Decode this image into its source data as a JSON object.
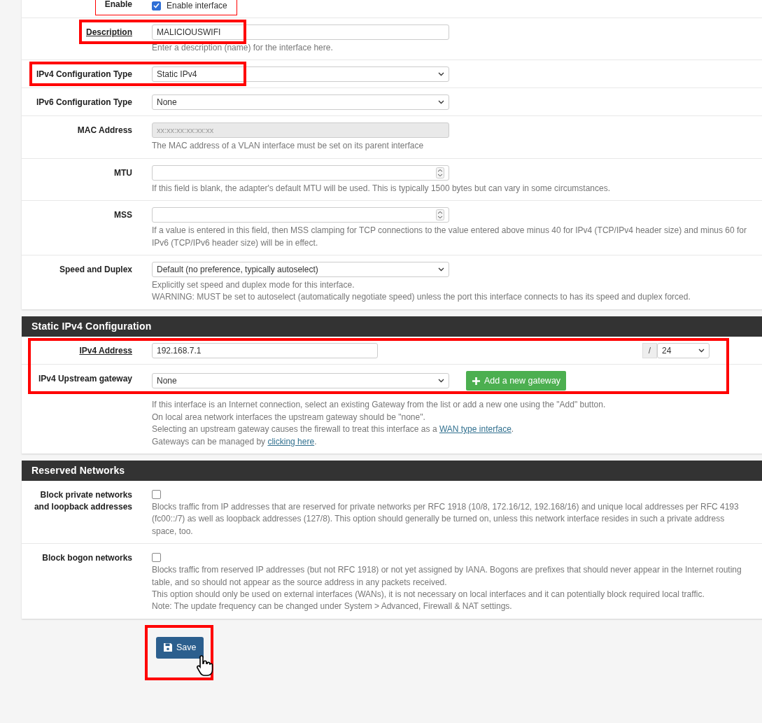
{
  "general": {
    "rows": [
      {
        "kind": "checkbox",
        "label": "Enable",
        "underlined": false,
        "checked": true,
        "option": "Enable interface",
        "highlighted": true
      },
      {
        "kind": "text",
        "label": "Description",
        "underlined": true,
        "value": "MALICIOUSWIFI",
        "highlighted": true,
        "help": [
          "Enter a description (name) for the interface here."
        ]
      },
      {
        "kind": "select",
        "label": "IPv4 Configuration Type",
        "underlined": false,
        "value": "Static IPv4",
        "highlighted": true
      },
      {
        "kind": "select",
        "label": "IPv6 Configuration Type",
        "underlined": false,
        "value": "None",
        "highlighted": false
      },
      {
        "kind": "text",
        "label": "MAC Address",
        "underlined": false,
        "placeholder": "xx:xx:xx:xx:xx:xx",
        "disabled": true,
        "highlighted": false,
        "help": [
          "The MAC address of a VLAN interface must be set on its parent interface"
        ]
      },
      {
        "kind": "number",
        "label": "MTU",
        "underlined": false,
        "highlighted": false,
        "help": [
          "If this field is blank, the adapter's default MTU will be used. This is typically 1500 bytes but can vary in some circumstances."
        ]
      },
      {
        "kind": "number",
        "label": "MSS",
        "underlined": false,
        "highlighted": false,
        "help": [
          "If a value is entered in this field, then MSS clamping for TCP connections to the value entered above minus 40 for IPv4 (TCP/IPv4 header size) and minus 60 for IPv6 (TCP/IPv6 header size) will be in effect."
        ]
      },
      {
        "kind": "select",
        "label": "Speed and Duplex",
        "underlined": false,
        "value": "Default (no preference, typically autoselect)",
        "highlighted": false,
        "help": [
          "Explicitly set speed and duplex mode for this interface.",
          "WARNING: MUST be set to autoselect (automatically negotiate speed) unless the port this interface connects to has its speed and duplex forced."
        ]
      }
    ]
  },
  "static_ipv4": {
    "title": "Static IPv4 Configuration",
    "highlighted": true,
    "rows": [
      {
        "kind": "address",
        "label": "IPv4 Address",
        "underlined": true,
        "value": "192.168.7.1",
        "separator": "/",
        "mask": "24"
      },
      {
        "kind": "gateway",
        "label": "IPv4 Upstream gateway",
        "underlined": false,
        "value": "None",
        "button": "Add a new gateway",
        "help": [
          "If this interface is an Internet connection, select an existing Gateway from the list or add a new one using the \"Add\" button.",
          "On local area network interfaces the upstream gateway should be \"none\".",
          {
            "text": "Selecting an upstream gateway causes the firewall to treat this interface as a ",
            "link": "WAN type interface",
            "after": "."
          },
          {
            "text": "Gateways can be managed by ",
            "link": "clicking here",
            "after": "."
          }
        ]
      }
    ]
  },
  "reserved_networks": {
    "title": "Reserved Networks",
    "highlighted": false,
    "rows": [
      {
        "kind": "checkbox",
        "label": "Block private networks and loopback addresses",
        "underlined": false,
        "checked": false,
        "highlighted": false,
        "help": [
          "Blocks traffic from IP addresses that are reserved for private networks per RFC 1918 (10/8, 172.16/12, 192.168/16) and unique local addresses per RFC 4193 (fc00::/7) as well as loopback addresses (127/8). This option should generally be turned on, unless this network interface resides in such a private address space, too."
        ]
      },
      {
        "kind": "checkbox",
        "label": "Block bogon networks",
        "underlined": false,
        "checked": false,
        "highlighted": false,
        "help": [
          "Blocks traffic from reserved IP addresses (but not RFC 1918) or not yet assigned by IANA. Bogons are prefixes that should never appear in the Internet routing table, and so should not appear as the source address in any packets received.",
          "This option should only be used on external interfaces (WANs), it is not necessary on local interfaces and it can potentially block required local traffic.",
          "Note: The update frequency can be changed under System > Advanced, Firewall & NAT settings."
        ]
      }
    ]
  },
  "save_button": {
    "label": "Save",
    "highlighted": true
  }
}
